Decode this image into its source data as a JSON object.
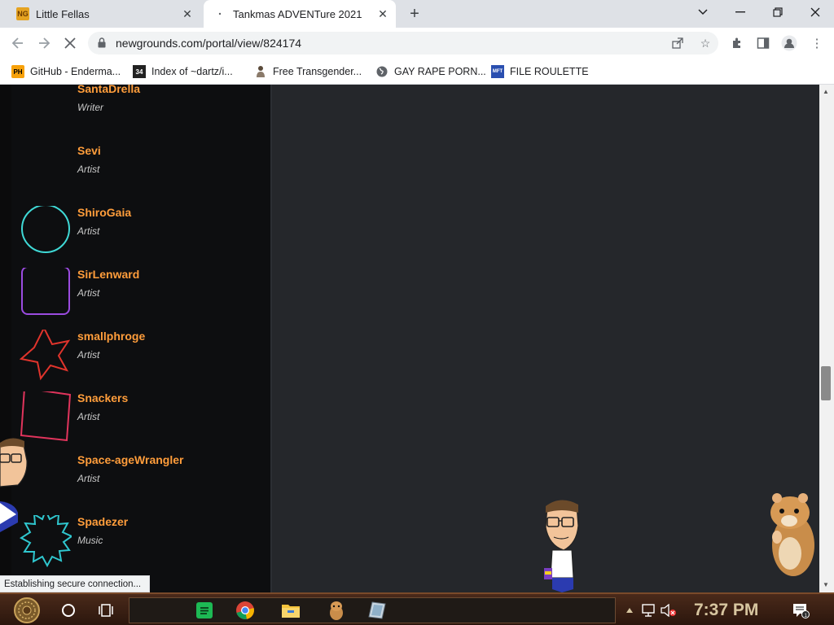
{
  "browser": {
    "tabs": [
      {
        "title": "Little Fellas",
        "favicon": "NG"
      },
      {
        "title": "Tankmas ADVENTure 2021"
      }
    ],
    "url": "newgrounds.com/portal/view/824174",
    "bookmarks": [
      {
        "label": "GitHub - Enderma...",
        "icon": "PH"
      },
      {
        "label": "Index of ~dartz/i...",
        "icon": "34"
      },
      {
        "label": "Free Transgender...",
        "icon": "figure-icon"
      },
      {
        "label": "GAY RAPE PORN...",
        "icon": "globe-icon"
      },
      {
        "label": "FILE ROULETTE",
        "icon": "MFT"
      }
    ],
    "status": "Establishing secure connection..."
  },
  "credits": [
    {
      "name": "SantaDrella",
      "role": "Writer",
      "shape": "none"
    },
    {
      "name": "Sevi",
      "role": "Artist",
      "shape": "none"
    },
    {
      "name": "ShiroGaia",
      "role": "Artist",
      "shape": "circle",
      "color": "#3fd9d6"
    },
    {
      "name": "SirLenward",
      "role": "Artist",
      "shape": "rounded-square",
      "color": "#9b4be0"
    },
    {
      "name": "smallphroge",
      "role": "Artist",
      "shape": "star",
      "color": "#e0342c"
    },
    {
      "name": "Snackers",
      "role": "Artist",
      "shape": "tilted-square",
      "color": "#e0345c"
    },
    {
      "name": "Space-ageWrangler",
      "role": "Artist",
      "shape": "none"
    },
    {
      "name": "Spadezer",
      "role": "Music",
      "shape": "burst",
      "color": "#2fc7cf"
    }
  ],
  "taskbar": {
    "clock": "7:37 PM",
    "apps": [
      "start-orb-icon",
      "cortana-icon",
      "task-view-icon",
      "spotify-icon",
      "chrome-icon",
      "file-explorer-icon",
      "hamster-icon",
      "tablet-icon"
    ]
  }
}
